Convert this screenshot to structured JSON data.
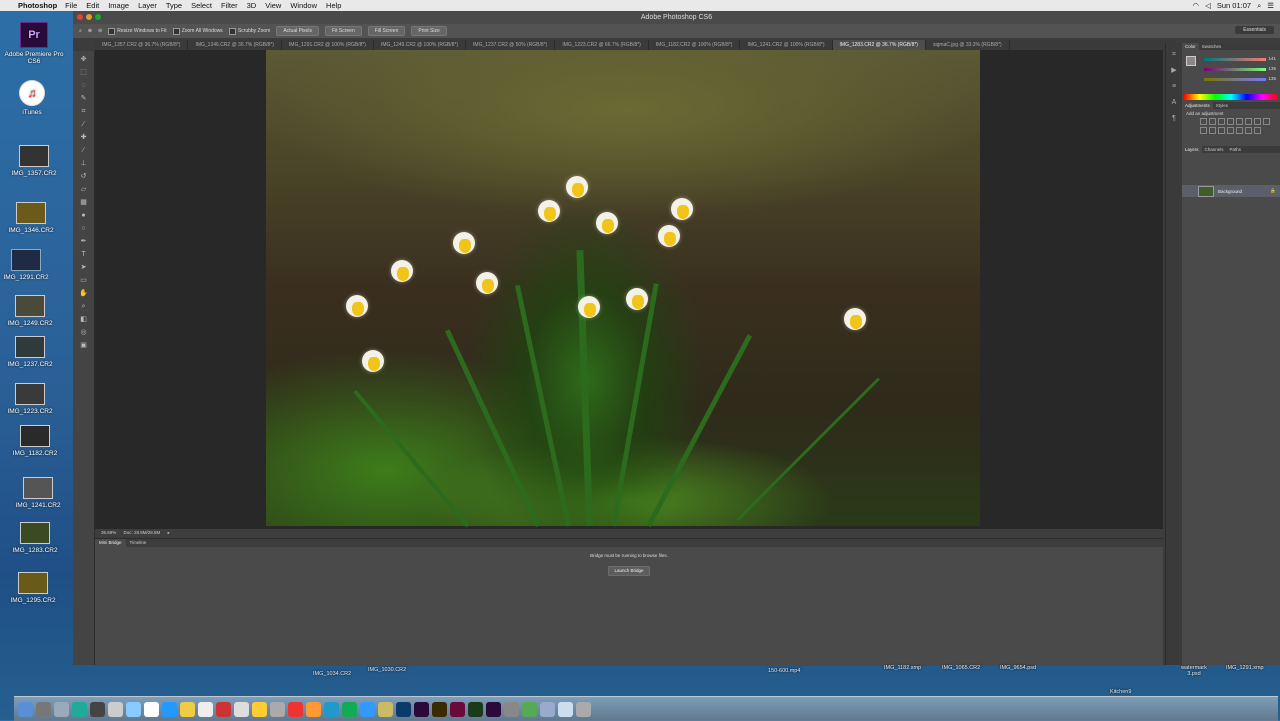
{
  "menubar": {
    "app": "Photoshop",
    "items": [
      "File",
      "Edit",
      "Image",
      "Layer",
      "Type",
      "Select",
      "Filter",
      "3D",
      "View",
      "Window",
      "Help"
    ],
    "clock": "Sun 01:07"
  },
  "desktop": {
    "icons": [
      {
        "label": "Adobe Premiere Pro CS6"
      },
      {
        "label": "iTunes"
      },
      {
        "label": "IMG_1357.CR2"
      },
      {
        "label": "IMG_1346.CR2"
      },
      {
        "label": "IMG_1291.CR2"
      },
      {
        "label": "IMG_1249.CR2"
      },
      {
        "label": "IMG_1237.CR2"
      },
      {
        "label": "IMG_1223.CR2"
      },
      {
        "label": "IMG_1182.CR2"
      },
      {
        "label": "IMG_1241.CR2"
      },
      {
        "label": "IMG_1283.CR2"
      },
      {
        "label": "IMG_1295.CR2"
      }
    ],
    "bottom_files": [
      "IMG_1034.CR2",
      "IMG_1030.CR2",
      "150-600.mp4",
      "IMG_1182.xmp",
      "IMG_1065.CR2",
      "IMG_9654.psd",
      "Kitchen9",
      "watermark 3.psd",
      "IMG_1291.xmp"
    ]
  },
  "photoshop": {
    "title": "Adobe Photoshop CS6",
    "options": {
      "resize": "Resize Windows to Fit",
      "zoom_all": "Zoom All Windows",
      "scrubby": "Scrubby Zoom",
      "actual": "Actual Pixels",
      "fit": "Fit Screen",
      "fill": "Fill Screen",
      "print": "Print Size",
      "workspace": "Essentials"
    },
    "tabs": [
      "IMG_1357.CR2 @ 36.7% (RGB/8*)",
      "IMG_1346.CR2 @ 36.7% (RGB/8*)",
      "IMG_1291.CR2 @ 100% (RGB/8*)",
      "IMG_1249.CR2 @ 100% (RGB/8*)",
      "IMG_1237.CR2 @ 50% (RGB/8*)",
      "IMG_1223.CR2 @ 66.7% (RGB/8*)",
      "IMG_1182.CR2 @ 100% (RGB/8*)",
      "IMG_1241.CR2 @ 100% (RGB/8*)",
      "IMG_1283.CR2 @ 36.7% (RGB/8*)",
      "sigmaC.jpg @ 33.3% (RGB/8*)"
    ],
    "active_tab": 8,
    "status": {
      "zoom": "36.69%",
      "doc": "Doc: 28.8M/28.8M"
    },
    "bottom_panel": {
      "tabs": [
        "Mini Bridge",
        "Timeline"
      ],
      "message": "Bridge must be running to browse files.",
      "button": "Launch Bridge"
    },
    "panels": {
      "color_tabs": [
        "Color",
        "Swatches"
      ],
      "color_values": [
        "141",
        "135",
        "135"
      ],
      "adjust_tabs": [
        "Adjustments",
        "Styles"
      ],
      "adjust_title": "Add an adjustment",
      "layer_tabs": [
        "Layers",
        "Channels",
        "Paths"
      ],
      "layer_name": "Background"
    }
  },
  "colors": {
    "menubar": "#e9e9e9",
    "ps_bg": "#3c3c3c",
    "daffodil_yellow": "#f0c419",
    "petal_white": "#f4f1e6"
  }
}
